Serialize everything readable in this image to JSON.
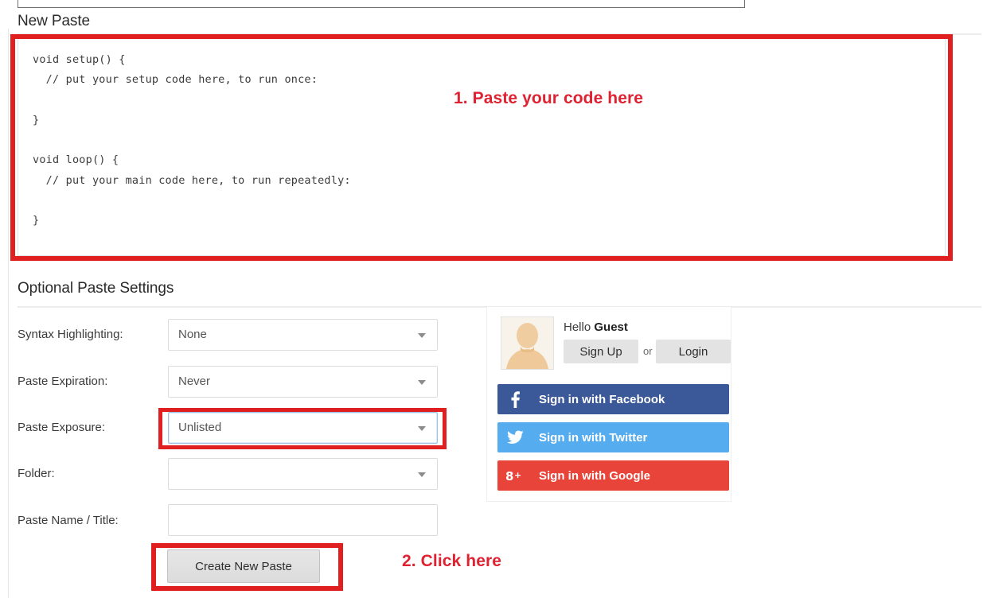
{
  "sections": {
    "new_paste_title": "New Paste",
    "optional_settings_title": "Optional Paste Settings"
  },
  "editor": {
    "name": "paste-code-textarea",
    "content": "void setup() {\n  // put your setup code here, to run once:\n\n}\n\nvoid loop() {\n  // put your main code here, to run repeatedly:\n\n}"
  },
  "annotations": [
    {
      "id": "step-1",
      "text": "1. Paste your code here",
      "color": "#df2231"
    },
    {
      "id": "step-2",
      "text": "2. Click here",
      "color": "#df2231"
    }
  ],
  "highlight_color": "#e02020",
  "form": {
    "syntax_highlighting": {
      "label": "Syntax Highlighting:",
      "value": "None"
    },
    "paste_expiration": {
      "label": "Paste Expiration:",
      "value": "Never"
    },
    "paste_exposure": {
      "label": "Paste Exposure:",
      "value": "Unlisted",
      "focused": true
    },
    "folder": {
      "label": "Folder:",
      "value": ""
    },
    "paste_name": {
      "label": "Paste Name / Title:",
      "value": "",
      "placeholder": ""
    },
    "submit_label": "Create New Paste"
  },
  "account": {
    "greeting_prefix": "Hello",
    "user_name": "Guest",
    "sign_up_label": "Sign Up",
    "or_label": "or",
    "login_label": "Login",
    "social": [
      {
        "id": "facebook",
        "label": "Sign in with Facebook",
        "color": "#3b5998",
        "icon": "facebook-icon"
      },
      {
        "id": "twitter",
        "label": "Sign in with Twitter",
        "color": "#55acee",
        "icon": "twitter-icon"
      },
      {
        "id": "google",
        "label": "Sign in with Google",
        "color": "#e8443a",
        "icon": "google-plus-icon"
      }
    ]
  }
}
